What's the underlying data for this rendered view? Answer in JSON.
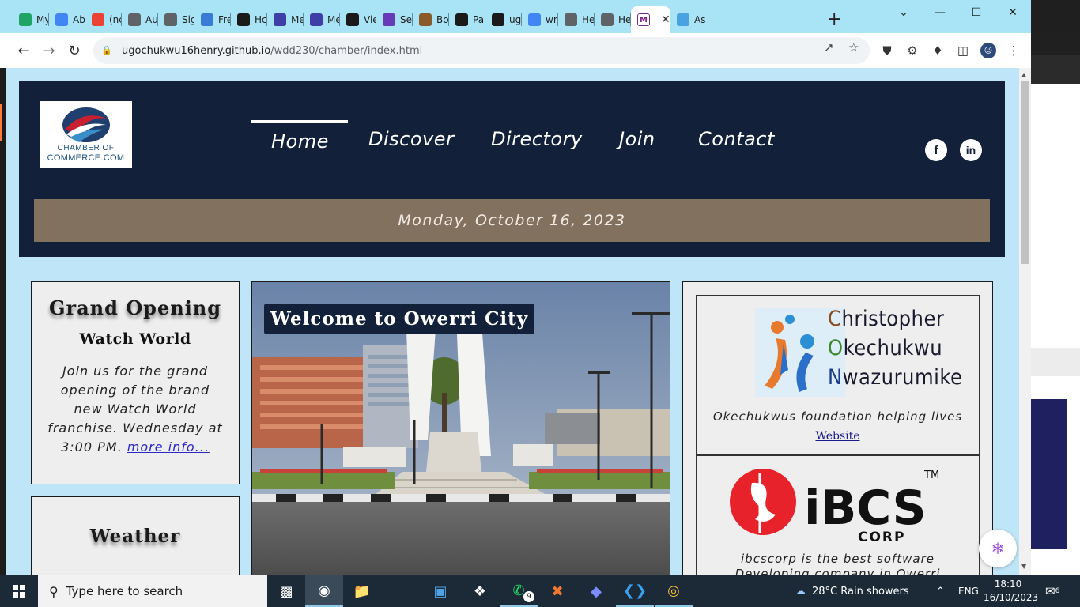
{
  "browser": {
    "tabs": [
      {
        "label": "My",
        "icon": "google-drive-icon",
        "color": "#1fa463"
      },
      {
        "label": "Ab",
        "icon": "google-docs-icon",
        "color": "#4285f4"
      },
      {
        "label": "(nc",
        "icon": "gmail-icon",
        "color": "#ea4335"
      },
      {
        "label": "Au",
        "icon": "globe-icon",
        "color": "#5f6368"
      },
      {
        "label": "Sig",
        "icon": "globe-icon",
        "color": "#5f6368"
      },
      {
        "label": "Fre",
        "icon": "pin-icon",
        "color": "#3a7bd5"
      },
      {
        "label": "Hc",
        "icon": "app-icon",
        "color": "#1a1a1a"
      },
      {
        "label": "Me",
        "icon": "forms-icon",
        "color": "#3f3fa8"
      },
      {
        "label": "Me",
        "icon": "forms-icon",
        "color": "#3f3fa8"
      },
      {
        "label": "Vie",
        "icon": "github-icon",
        "color": "#1a1a1a"
      },
      {
        "label": "Se",
        "icon": "forms-icon",
        "color": "#673ab7"
      },
      {
        "label": "Bo",
        "icon": "image-icon",
        "color": "#8a5a2a"
      },
      {
        "label": "Pa",
        "icon": "github-icon",
        "color": "#1a1a1a"
      },
      {
        "label": "ug",
        "icon": "github-icon",
        "color": "#1a1a1a"
      },
      {
        "label": "wr",
        "icon": "google-icon",
        "color": "#4285f4"
      },
      {
        "label": "He",
        "icon": "globe-icon",
        "color": "#5f6368"
      },
      {
        "label": "He",
        "icon": "globe-icon",
        "color": "#5f6368"
      }
    ],
    "active_tab": {
      "icon": "chamber-favicon-icon",
      "close": "✕"
    },
    "after_tab": {
      "label": "As",
      "icon": "cloud-icon"
    },
    "new_tab": "+",
    "window": {
      "minimize": "—",
      "maximize": "☐",
      "close": "✕",
      "tab_search": "⌄"
    },
    "url": {
      "host": "ugochukwu16henry.github.io",
      "path": "/wdd230/chamber/index.html"
    }
  },
  "site": {
    "logo": {
      "line1": "CHAMBER OF",
      "line2": "COMMERCE.COM"
    },
    "nav": [
      {
        "label": "Home",
        "active": true
      },
      {
        "label": "Discover"
      },
      {
        "label": "Directory"
      },
      {
        "label": "Join"
      },
      {
        "label": "Contact"
      }
    ],
    "social": [
      {
        "label": "f",
        "icon": "facebook-icon"
      },
      {
        "label": "in",
        "icon": "linkedin-icon"
      }
    ],
    "date": "Monday, October 16, 2023",
    "opening": {
      "title": "Grand Opening",
      "subtitle": "Watch World",
      "body": "Join us for the grand opening of the brand new Watch World franchise. Wednesday at 3:00 PM.",
      "link": "more info..."
    },
    "weather": {
      "title": "Weather"
    },
    "hero": {
      "caption": "Welcome to Owerri City"
    },
    "spotlights": [
      {
        "name_lines": [
          {
            "first": "C",
            "rest": "hristopher"
          },
          {
            "first": "O",
            "rest": "kechukwu"
          },
          {
            "first": "N",
            "rest": "wazurumike"
          }
        ],
        "tagline": "Okechukwus foundation helping lives",
        "link": "Website"
      },
      {
        "brand": "iBCS",
        "tm": "TM",
        "sub": "CORP",
        "tagline_1": "ibcscorp is the best software",
        "tagline_2": "Developing company in Owerri"
      }
    ]
  },
  "taskbar": {
    "search_placeholder": "Type here to search",
    "weather": "28°C  Rain showers",
    "lang": "ENG",
    "time": "18:10",
    "date": "16/10/2023",
    "notifications": "6",
    "whatsapp_badge": "9"
  },
  "colors": {
    "header_bg": "#12203a",
    "datebar_bg": "#83715f",
    "page_bg": "#bfe6f8",
    "card_bg": "#efeeee",
    "tabstrip_bg": "#a9e4f6"
  }
}
